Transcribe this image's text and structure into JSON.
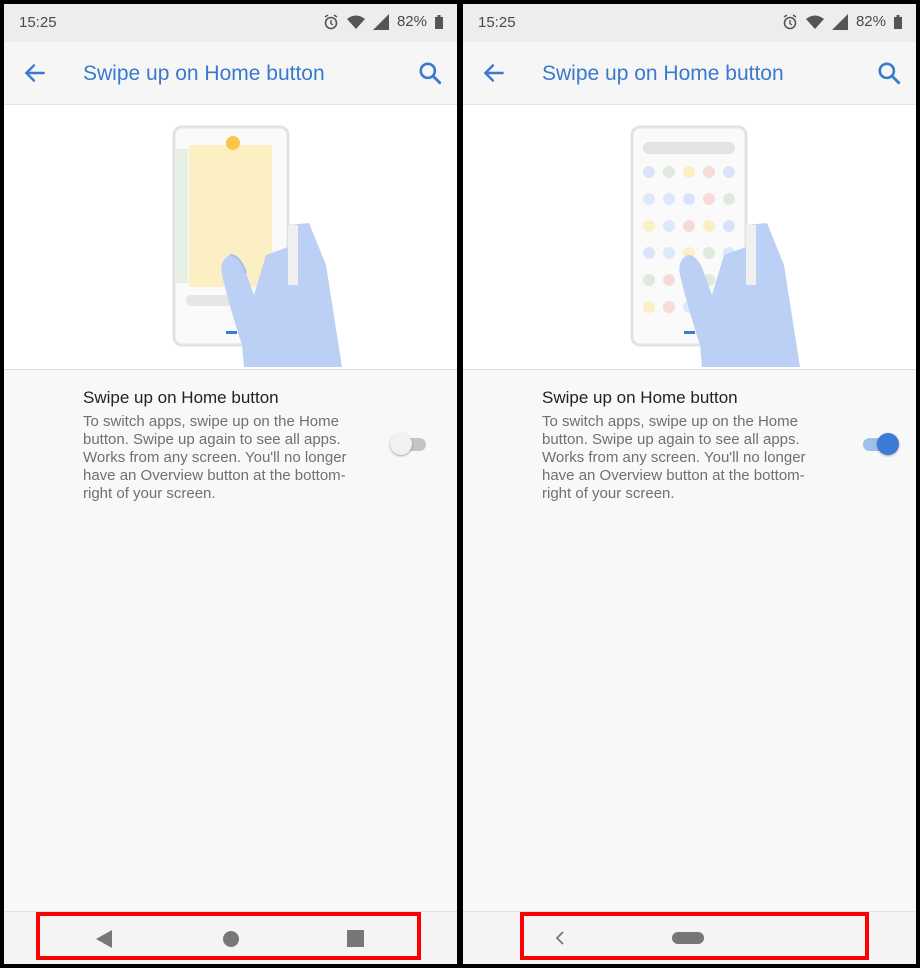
{
  "status_bar": {
    "time": "15:25",
    "battery": "82%",
    "icons": [
      "alarm-icon",
      "wifi-icon",
      "signal-icon",
      "battery-icon"
    ]
  },
  "app_bar": {
    "title": "Swipe up on Home button",
    "back_icon": "arrow-back-icon",
    "search_icon": "search-icon"
  },
  "setting": {
    "title": "Swipe up on Home button",
    "description": "To switch apps, swipe up on the Home button. Swipe up again to see all apps. Works from any screen. You'll no longer have an Overview button at the bottom-right of your screen."
  },
  "panels": {
    "left": {
      "toggle_state": "off",
      "nav_buttons": [
        "back-triangle-icon",
        "home-circle-icon",
        "overview-square-icon"
      ]
    },
    "right": {
      "toggle_state": "on",
      "nav_buttons": [
        "back-chevron-icon",
        "home-pill-icon"
      ]
    }
  },
  "colors": {
    "accent": "#3a79cc",
    "toggle_on": "#3d7bd6",
    "highlight": "#ff0000"
  }
}
